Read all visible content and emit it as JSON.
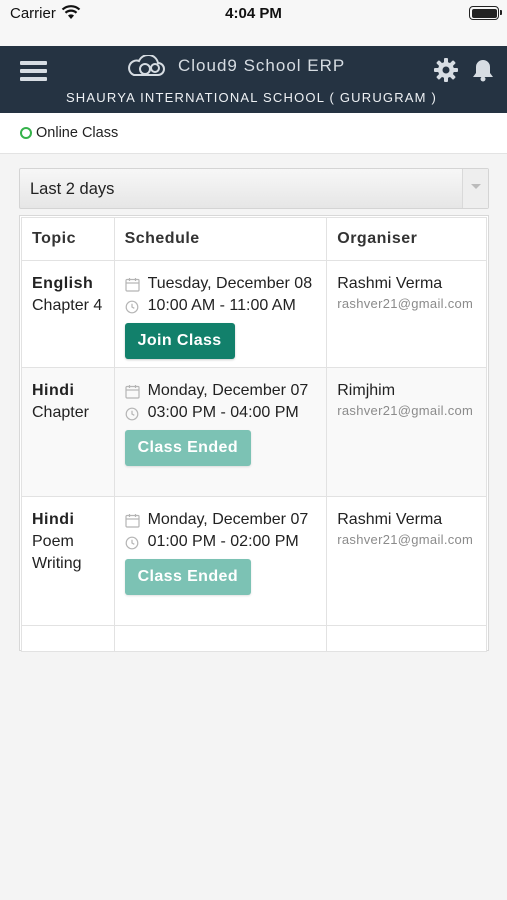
{
  "status_bar": {
    "carrier": "Carrier",
    "time": "4:04 PM"
  },
  "header": {
    "app_title": "Cloud9 School ERP",
    "school_name": "SHAURYA INTERNATIONAL SCHOOL ( GURUGRAM )",
    "background": "#253342"
  },
  "breadcrumb": {
    "label": "Online Class",
    "status_color": "#35b24a"
  },
  "filter": {
    "selected": "Last 2 days"
  },
  "table": {
    "headers": {
      "topic": "Topic",
      "schedule": "Schedule",
      "organiser": "Organiser"
    },
    "rows": [
      {
        "subject": "English",
        "topic_lines": [
          "Chapter 4"
        ],
        "date": "Tuesday, December 08",
        "time": "10:00 AM - 11:00 AM",
        "action": "Join Class",
        "organiser": "Rashmi Verma",
        "email": "rashver21@gmail.com"
      },
      {
        "subject": "Hindi",
        "topic_lines": [
          "Chapter"
        ],
        "date": "Monday, December 07",
        "time": "03:00 PM - 04:00 PM",
        "action": "Class Ended",
        "organiser": "Rimjhim",
        "email": "rashver21@gmail.com"
      },
      {
        "subject": "Hindi",
        "topic_lines": [
          "Poem",
          "Writing"
        ],
        "date": "Monday, December 07",
        "time": "01:00 PM - 02:00 PM",
        "action": "Class Ended",
        "organiser": "Rashmi Verma",
        "email": "rashver21@gmail.com"
      }
    ]
  },
  "colors": {
    "join_button": "#12806b",
    "ended_button": "#7cc2b4"
  },
  "icons": [
    "wifi-icon",
    "battery-icon",
    "menu-icon",
    "cloud9-logo-icon",
    "gear-icon",
    "bell-icon",
    "calendar-icon",
    "clock-icon",
    "chevron-down-icon"
  ]
}
